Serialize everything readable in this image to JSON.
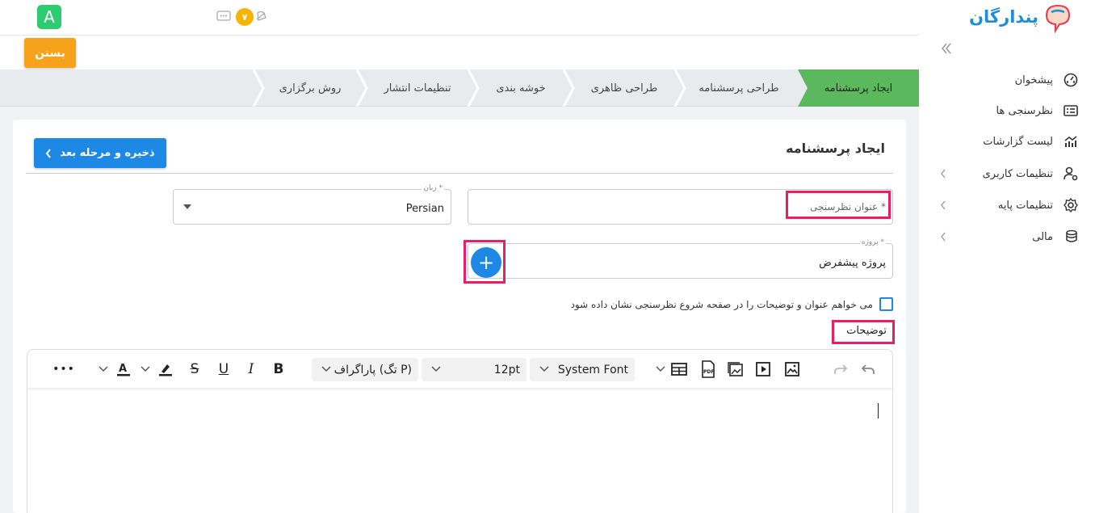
{
  "brand": {
    "name": "پندارگان"
  },
  "topbar": {
    "avatar_letter": "A",
    "notif_count": "۷"
  },
  "actions": {
    "close_label": "بستن",
    "save_next_label": "ذخیره و مرحله بعد"
  },
  "steps": [
    {
      "label": "ایجاد پرسشنامه",
      "active": true
    },
    {
      "label": "طراحی پرسشنامه",
      "active": false
    },
    {
      "label": "طراحی ظاهری",
      "active": false
    },
    {
      "label": "خوشه بندی",
      "active": false
    },
    {
      "label": "تنظیمات انتشار",
      "active": false
    },
    {
      "label": "روش برگزاری",
      "active": false
    }
  ],
  "sidebar": {
    "items": [
      {
        "label": "پیشخوان",
        "icon": "dashboard-icon"
      },
      {
        "label": "نظرسنجی ها",
        "icon": "list-icon"
      },
      {
        "label": "لیست گزارشات",
        "icon": "chart-icon"
      },
      {
        "label": "تنظیمات کاربری",
        "icon": "user-settings-icon"
      },
      {
        "label": "تنظیمات پایه",
        "icon": "gear-icon"
      },
      {
        "label": "مالی",
        "icon": "coins-icon"
      }
    ]
  },
  "form": {
    "title": "ایجاد پرسشنامه",
    "survey_title_placeholder": "عنوان نظرسنجی *",
    "language_label": "زبان *",
    "language_value": "Persian",
    "project_label": "پروژه *",
    "project_value": "پروژه پیشفرض",
    "show_title_checkbox": "می خواهم عنوان و توضیحات را در صفحه شروع نظرسنجی نشان داده شود",
    "description_label": "توضیحات"
  },
  "editor": {
    "font_family": "System Font",
    "font_size": "12pt",
    "block_format": "پاراگراف (تگ P)",
    "more": "•••"
  },
  "colors": {
    "accent": "#1e88e5",
    "active_step": "#5cb85c",
    "close": "#f7a21b",
    "highlight": "#e91e63"
  }
}
